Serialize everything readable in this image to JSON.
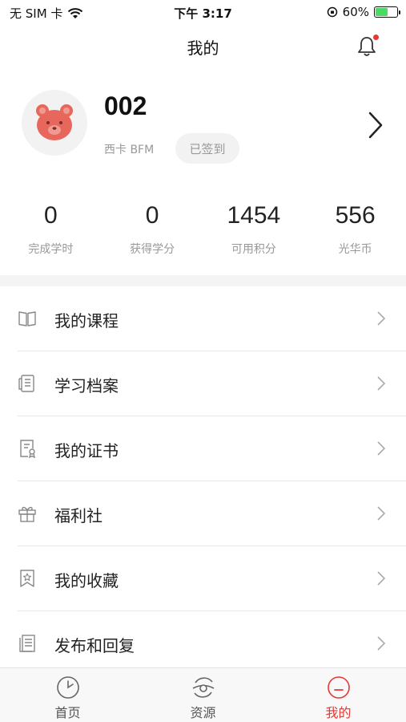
{
  "status_bar": {
    "carrier": "无 SIM 卡",
    "time": "下午 3:17",
    "battery_percent": "60%",
    "battery_level": 0.6
  },
  "header": {
    "title": "我的"
  },
  "profile": {
    "username": "002",
    "subtitle": "西卡 BFM",
    "checkin_label": "已签到"
  },
  "stats": [
    {
      "value": "0",
      "label": "完成学时"
    },
    {
      "value": "0",
      "label": "获得学分"
    },
    {
      "value": "1454",
      "label": "可用积分"
    },
    {
      "value": "556",
      "label": "光华币"
    }
  ],
  "menu": [
    {
      "label": "我的课程",
      "icon": "book-icon"
    },
    {
      "label": "学习档案",
      "icon": "document-icon"
    },
    {
      "label": "我的证书",
      "icon": "certificate-icon"
    },
    {
      "label": "福利社",
      "icon": "gift-icon"
    },
    {
      "label": "我的收藏",
      "icon": "bookmark-star-icon"
    },
    {
      "label": "发布和回复",
      "icon": "notes-icon"
    }
  ],
  "tab_bar": {
    "tabs": [
      {
        "label": "首页",
        "icon": "clock-icon",
        "active": false
      },
      {
        "label": "资源",
        "icon": "discover-icon",
        "active": false
      },
      {
        "label": "我的",
        "icon": "profile-smile-icon",
        "active": true
      }
    ]
  },
  "colors": {
    "accent": "#e53935",
    "avatar_bear": "#e8675c",
    "battery_charging": "#4cd964"
  }
}
